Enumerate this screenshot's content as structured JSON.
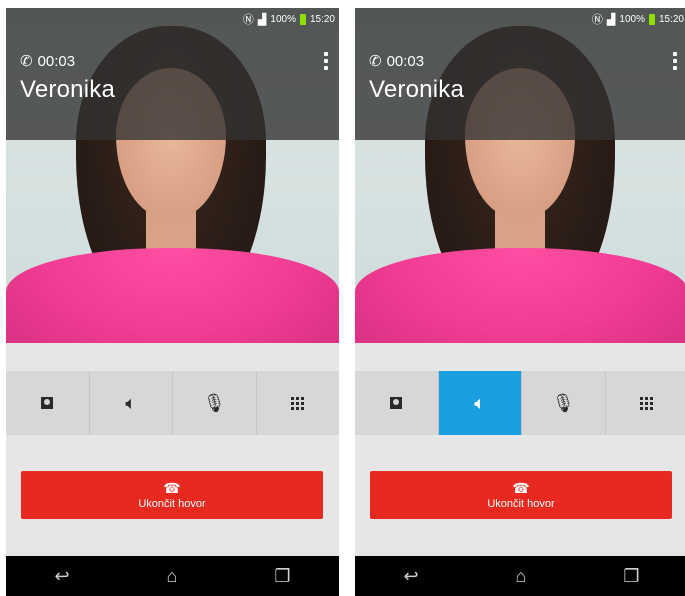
{
  "screens": [
    {
      "status_bar": {
        "nfc_icon": "nfc-icon",
        "signal_icon": "signal-icon",
        "battery_text": "100%",
        "time": "15:20"
      },
      "call": {
        "duration": "00:03",
        "contact_name": "Veronika"
      },
      "controls": [
        {
          "icon": "contact-card-icon",
          "active": false
        },
        {
          "icon": "speaker-icon",
          "active": false
        },
        {
          "icon": "mute-mic-icon",
          "active": false
        },
        {
          "icon": "dialpad-icon",
          "active": false
        }
      ],
      "end_call_label": "Ukončit hovor",
      "nav": [
        "back-icon",
        "home-icon",
        "recents-icon"
      ]
    },
    {
      "status_bar": {
        "nfc_icon": "nfc-icon",
        "signal_icon": "signal-icon",
        "battery_text": "100%",
        "time": "15:20"
      },
      "call": {
        "duration": "00:03",
        "contact_name": "Veronika"
      },
      "controls": [
        {
          "icon": "contact-card-icon",
          "active": false
        },
        {
          "icon": "speaker-icon",
          "active": true
        },
        {
          "icon": "mute-mic-icon",
          "active": false
        },
        {
          "icon": "dialpad-icon",
          "active": false
        }
      ],
      "end_call_label": "Ukončit hovor",
      "nav": [
        "back-icon",
        "home-icon",
        "recents-icon"
      ]
    }
  ],
  "colors": {
    "accent_active": "#1a9fe0",
    "end_call": "#e8291f",
    "battery": "#8ee000"
  }
}
